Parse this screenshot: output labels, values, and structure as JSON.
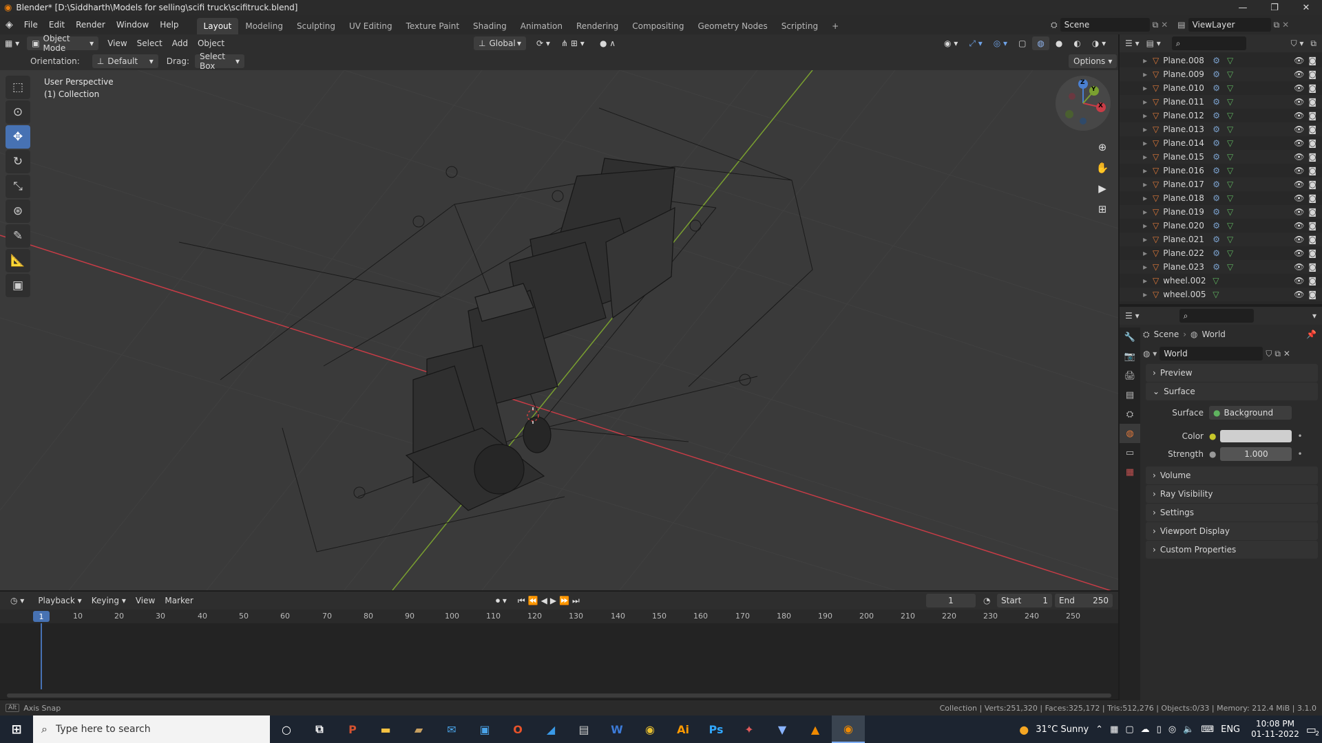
{
  "window": {
    "title": "Blender* [D:\\Siddharth\\Models for selling\\scifi truck\\scifitruck.blend]",
    "minimize": "—",
    "maximize": "❐",
    "close": "✕"
  },
  "menu": [
    "File",
    "Edit",
    "Render",
    "Window",
    "Help"
  ],
  "workspaces": [
    "Layout",
    "Modeling",
    "Sculpting",
    "UV Editing",
    "Texture Paint",
    "Shading",
    "Animation",
    "Rendering",
    "Compositing",
    "Geometry Nodes",
    "Scripting",
    "+"
  ],
  "active_workspace": "Layout",
  "scene": {
    "label": "Scene",
    "viewlayer": "ViewLayer"
  },
  "viewport_header": {
    "mode": "Object Mode",
    "menus": [
      "View",
      "Select",
      "Add",
      "Object"
    ],
    "transform": "Global"
  },
  "tool_settings": {
    "orientation_label": "Orientation:",
    "orientation_value": "Default",
    "drag_label": "Drag:",
    "drag_value": "Select Box",
    "options": "Options"
  },
  "viewport": {
    "perspective": "User Perspective",
    "collection": "(1) Collection",
    "gizmo": {
      "x": "X",
      "y": "Y",
      "z": "Z"
    }
  },
  "outliner": {
    "items": [
      "Plane.008",
      "Plane.009",
      "Plane.010",
      "Plane.011",
      "Plane.012",
      "Plane.013",
      "Plane.014",
      "Plane.015",
      "Plane.016",
      "Plane.017",
      "Plane.018",
      "Plane.019",
      "Plane.020",
      "Plane.021",
      "Plane.022",
      "Plane.023",
      "wheel.002",
      "wheel.005"
    ]
  },
  "properties": {
    "breadcrumb_scene": "Scene",
    "breadcrumb_world": "World",
    "world_name": "World",
    "panels": {
      "preview": "Preview",
      "surface": "Surface",
      "volume": "Volume",
      "ray_visibility": "Ray Visibility",
      "settings": "Settings",
      "viewport_display": "Viewport Display",
      "custom_properties": "Custom Properties"
    },
    "surface_label": "Surface",
    "surface_value": "Background",
    "color_label": "Color",
    "strength_label": "Strength",
    "strength_value": "1.000"
  },
  "timeline": {
    "menus": [
      "Playback",
      "Keying",
      "View",
      "Marker"
    ],
    "current_frame": "1",
    "start_label": "Start",
    "start_value": "1",
    "end_label": "End",
    "end_value": "250",
    "ruler": [
      "1",
      "10",
      "20",
      "30",
      "40",
      "50",
      "60",
      "70",
      "80",
      "90",
      "100",
      "110",
      "120",
      "130",
      "140",
      "150",
      "160",
      "170",
      "180",
      "190",
      "200",
      "210",
      "220",
      "230",
      "240",
      "250"
    ]
  },
  "statusbar": {
    "left": "Axis Snap",
    "right": "Collection | Verts:251,320 | Faces:325,172 | Tris:512,276 | Objects:0/33 | Memory: 212.4 MiB | 3.1.0"
  },
  "taskbar": {
    "search_placeholder": "Type here to search",
    "weather": "31°C  Sunny",
    "lang": "ENG",
    "time": "10:08 PM",
    "date": "01-11-2022",
    "notifications": "2"
  },
  "colors": {
    "accent": "#4772b3",
    "x_axis": "#c83c46",
    "y_axis": "#7aa030",
    "object_orange": "#e07a3a"
  }
}
